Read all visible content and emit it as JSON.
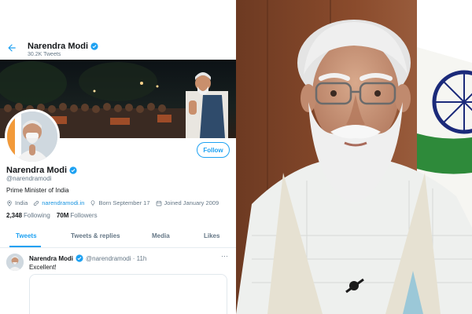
{
  "profile": {
    "name": "Narendra Modi",
    "tweet_count": "30.2K Tweets",
    "handle": "@narendramodi",
    "bio": "Prime Minister of India",
    "location": "India",
    "website": "narendramodi.in",
    "born": "Born September 17",
    "joined": "Joined January 2009",
    "following_count": "2,348",
    "following_label": "Following",
    "followers_count": "70M",
    "followers_label": "Followers",
    "follow_label": "Follow"
  },
  "tabs": [
    {
      "label": "Tweets",
      "active": true
    },
    {
      "label": "Tweets & replies",
      "active": false
    },
    {
      "label": "Media",
      "active": false
    },
    {
      "label": "Likes",
      "active": false
    }
  ],
  "tweet": {
    "name": "Narendra Modi",
    "handle_time": "@narendramodi · 11h",
    "text": "Excellent!",
    "more": "···"
  },
  "icons": {
    "back": "arrow-left-icon",
    "verified": "verified-badge-icon",
    "location": "location-pin-icon",
    "link": "link-icon",
    "birthday": "balloon-icon",
    "calendar": "calendar-icon"
  },
  "colors": {
    "accent": "#1da1f2",
    "link": "#1b95e0",
    "muted": "#657786",
    "text": "#14171a"
  }
}
